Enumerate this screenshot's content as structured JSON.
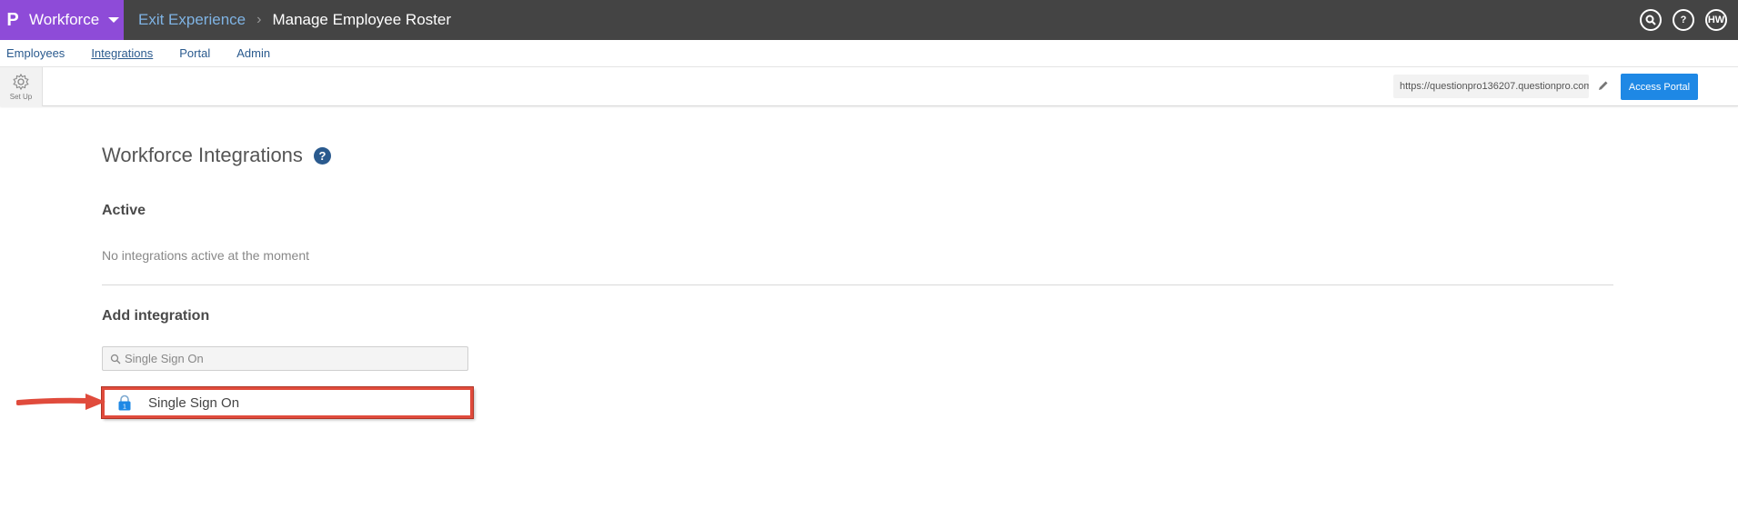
{
  "topbar": {
    "logo_char": "P",
    "app_name": "Workforce",
    "breadcrumb_link": "Exit Experience",
    "breadcrumb_sep": "›",
    "breadcrumb_current": "Manage Employee Roster",
    "help_label": "?",
    "user_initials": "HW"
  },
  "nav": {
    "items": [
      {
        "label": "Employees"
      },
      {
        "label": "Integrations"
      },
      {
        "label": "Portal"
      },
      {
        "label": "Admin"
      }
    ]
  },
  "toolbar": {
    "setup_label": "Set Up",
    "portal_url": "https://questionpro136207.questionpro.com",
    "access_label": "Access Portal"
  },
  "main": {
    "title": "Workforce Integrations",
    "help_glyph": "?",
    "active_heading": "Active",
    "empty_message": "No integrations active at the moment",
    "add_heading": "Add integration",
    "search_value": "Single Sign On",
    "result_label": "Single Sign On",
    "result_badge": "1"
  },
  "colors": {
    "brand": "#8e4bd8",
    "topbar": "#444444",
    "primary_button": "#1e88e5",
    "highlight_box": "#e04b3c"
  }
}
